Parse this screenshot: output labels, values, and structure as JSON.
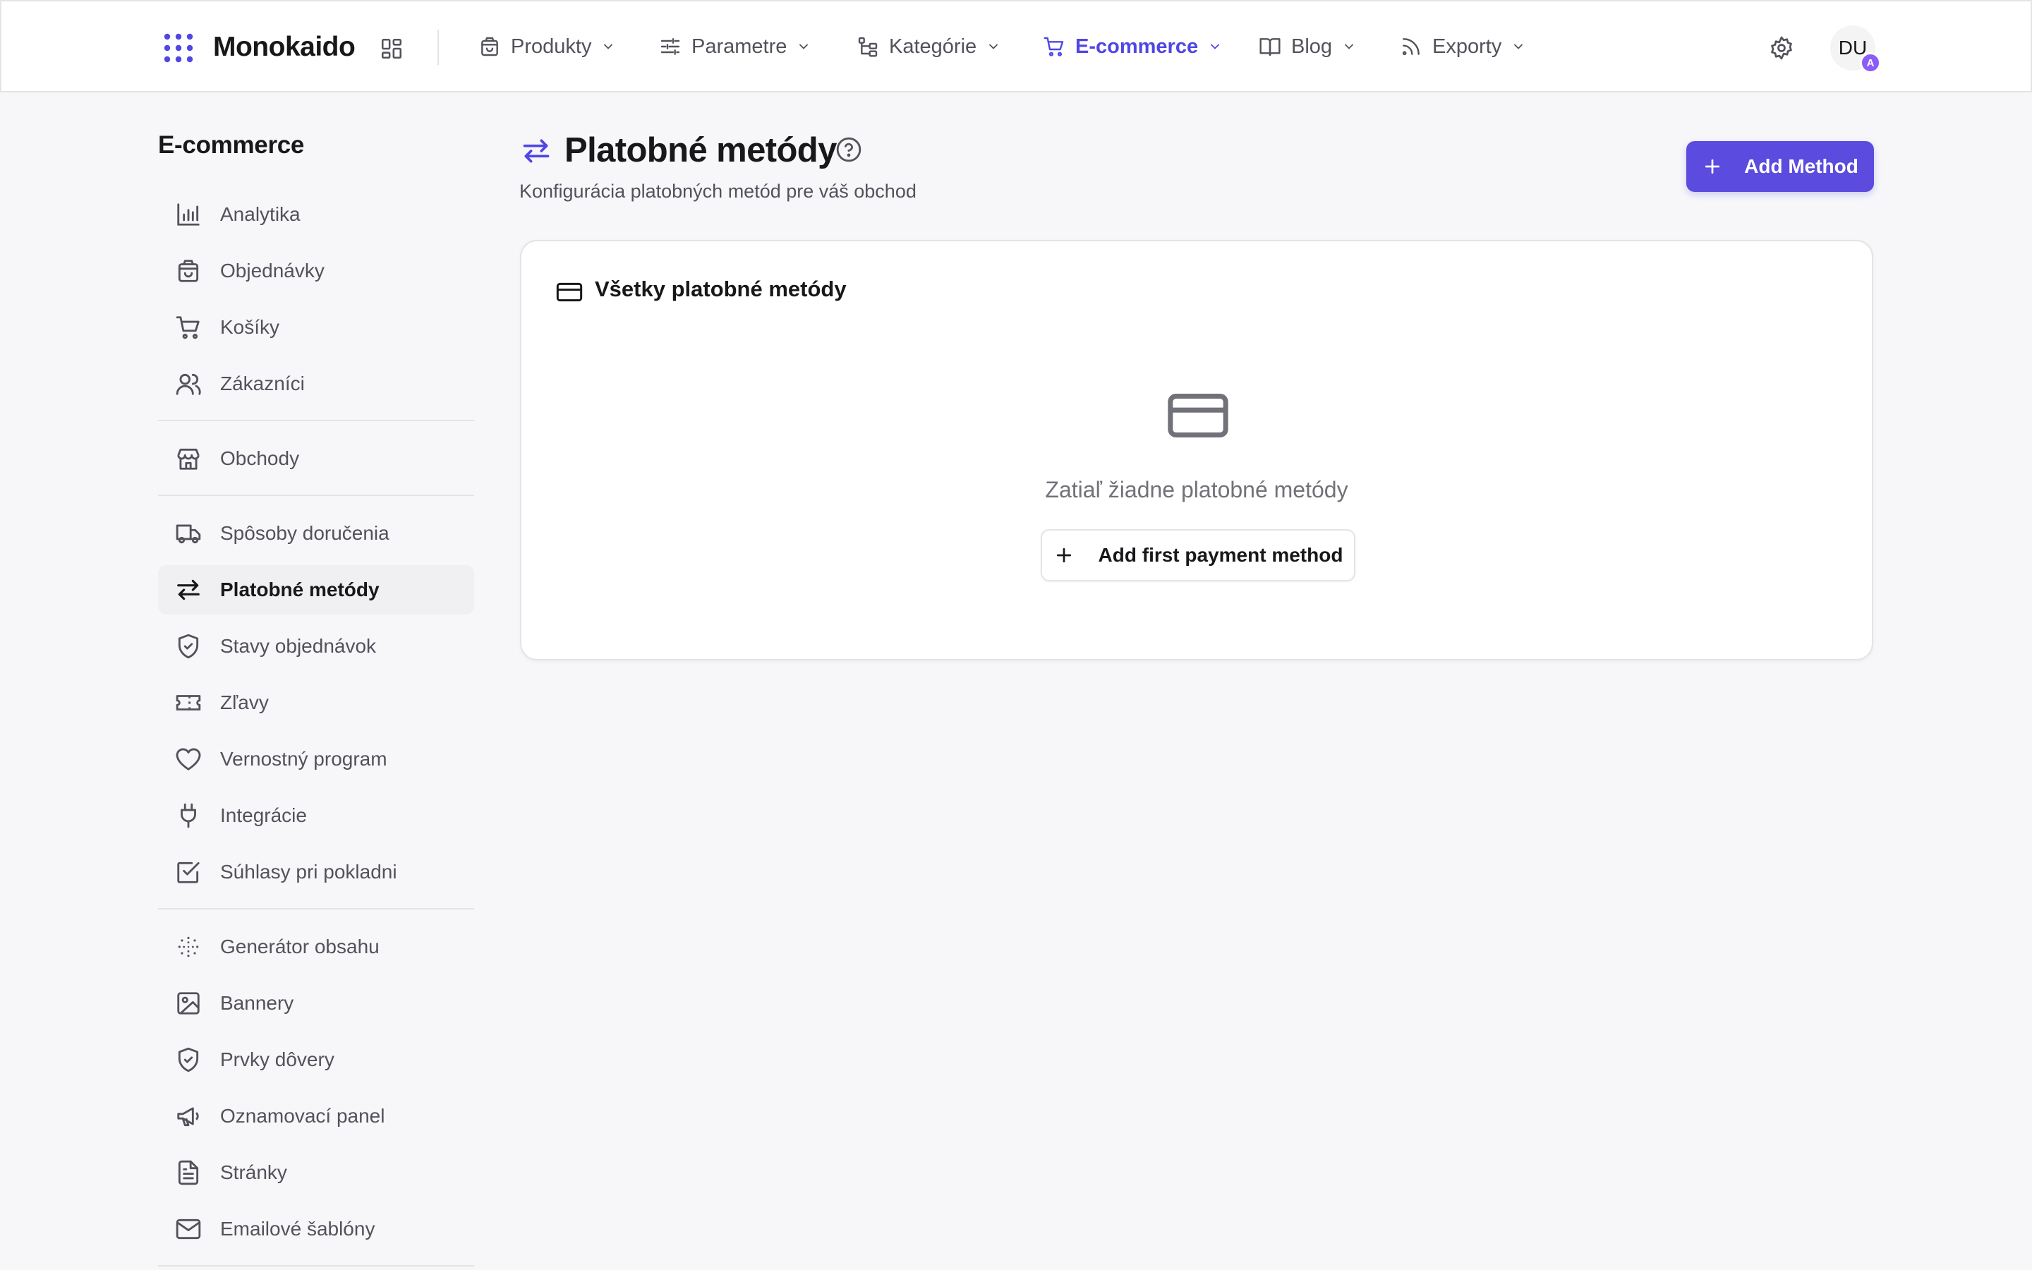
{
  "brand": {
    "name": "Monokaido",
    "accent": "#4f46e5"
  },
  "topnav": {
    "items": [
      {
        "label": "Produkty",
        "icon": "shopping-bag-icon"
      },
      {
        "label": "Parametre",
        "icon": "sliders-icon"
      },
      {
        "label": "Kategórie",
        "icon": "tree-icon"
      },
      {
        "label": "E-commerce",
        "icon": "cart-icon",
        "active": true
      },
      {
        "label": "Blog",
        "icon": "book-icon"
      },
      {
        "label": "Exporty",
        "icon": "rss-icon"
      }
    ],
    "avatar_initials": "DU",
    "avatar_badge": "A"
  },
  "sidebar": {
    "title": "E-commerce",
    "items": [
      {
        "label": "Analytika",
        "icon": "bar-chart-icon"
      },
      {
        "label": "Objednávky",
        "icon": "shopping-bag-icon"
      },
      {
        "label": "Košíky",
        "icon": "cart-icon"
      },
      {
        "label": "Zákazníci",
        "icon": "users-icon"
      },
      {
        "label": "Obchody",
        "icon": "store-icon"
      },
      {
        "label": "Spôsoby doručenia",
        "icon": "truck-icon"
      },
      {
        "label": "Platobné metódy",
        "icon": "arrows-exchange-icon",
        "active": true
      },
      {
        "label": "Stavy objednávok",
        "icon": "shield-check-icon"
      },
      {
        "label": "Zľavy",
        "icon": "ticket-icon"
      },
      {
        "label": "Vernostný program",
        "icon": "heart-icon"
      },
      {
        "label": "Integrácie",
        "icon": "plug-icon"
      },
      {
        "label": "Súhlasy pri pokladni",
        "icon": "checkbox-icon"
      },
      {
        "label": "Generátor obsahu",
        "icon": "dots-circle-icon"
      },
      {
        "label": "Bannery",
        "icon": "image-icon"
      },
      {
        "label": "Prvky dôvery",
        "icon": "shield-check-icon"
      },
      {
        "label": "Oznamovací panel",
        "icon": "megaphone-icon"
      },
      {
        "label": "Stránky",
        "icon": "file-text-icon"
      },
      {
        "label": "Emailové šablóny",
        "icon": "mail-icon"
      }
    ]
  },
  "page": {
    "title": "Platobné metódy",
    "subtitle": "Konfigurácia platobných metód pre váš obchod",
    "add_button": "Add Method"
  },
  "card": {
    "title": "Všetky platobné metódy",
    "empty_text": "Zatiaľ žiadne platobné metódy",
    "add_first_button": "Add first payment method"
  }
}
